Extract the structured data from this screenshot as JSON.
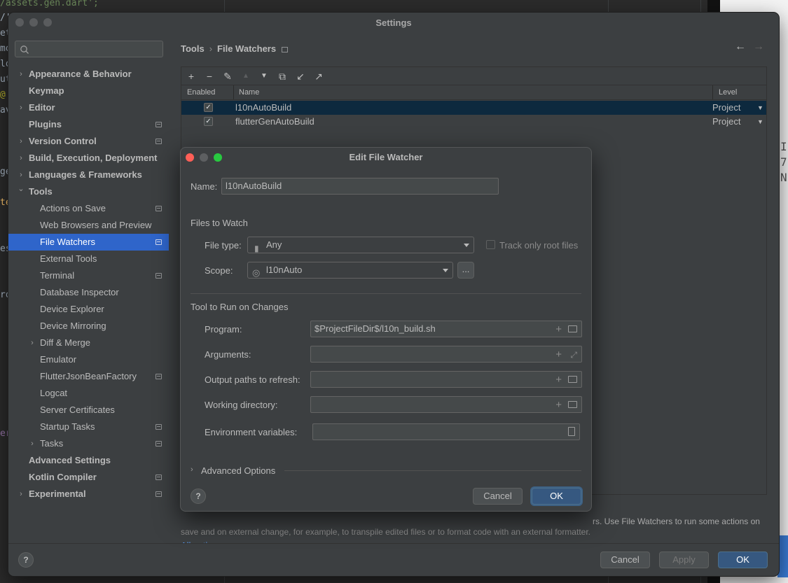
{
  "background_editor": {
    "code_lines": [
      "/assets.gen.dart';",
      "/'",
      "et",
      "mo",
      "lo",
      "ut",
      "@",
      "av",
      "ge",
      "te",
      "es",
      "ro",
      "er"
    ],
    "right_panel_glyphs": [
      "I",
      "7",
      "N"
    ]
  },
  "settings": {
    "window_title": "Settings",
    "search": {
      "placeholder": "",
      "value": ""
    },
    "sidebar": {
      "items": [
        {
          "label": "Appearance & Behavior",
          "bold": true,
          "arrow": "›",
          "level": 0,
          "project": false
        },
        {
          "label": "Keymap",
          "bold": true,
          "arrow": "",
          "level": 0,
          "project": false
        },
        {
          "label": "Editor",
          "bold": true,
          "arrow": "›",
          "level": 0,
          "project": false
        },
        {
          "label": "Plugins",
          "bold": true,
          "arrow": "",
          "level": 0,
          "project": true
        },
        {
          "label": "Version Control",
          "bold": true,
          "arrow": "›",
          "level": 0,
          "project": true
        },
        {
          "label": "Build, Execution, Deployment",
          "bold": true,
          "arrow": "›",
          "level": 0,
          "project": false
        },
        {
          "label": "Languages & Frameworks",
          "bold": true,
          "arrow": "›",
          "level": 0,
          "project": false
        },
        {
          "label": "Tools",
          "bold": true,
          "arrow": "⌄",
          "level": 0,
          "project": false
        },
        {
          "label": "Actions on Save",
          "bold": false,
          "arrow": "",
          "level": 1,
          "project": true
        },
        {
          "label": "Web Browsers and Preview",
          "bold": false,
          "arrow": "",
          "level": 1,
          "project": false
        },
        {
          "label": "File Watchers",
          "bold": true,
          "arrow": "",
          "level": 1,
          "project": true,
          "selected": true
        },
        {
          "label": "External Tools",
          "bold": false,
          "arrow": "",
          "level": 1,
          "project": false
        },
        {
          "label": "Terminal",
          "bold": false,
          "arrow": "",
          "level": 1,
          "project": true
        },
        {
          "label": "Database Inspector",
          "bold": false,
          "arrow": "",
          "level": 1,
          "project": false
        },
        {
          "label": "Device Explorer",
          "bold": false,
          "arrow": "",
          "level": 1,
          "project": false
        },
        {
          "label": "Device Mirroring",
          "bold": false,
          "arrow": "",
          "level": 1,
          "project": false
        },
        {
          "label": "Diff & Merge",
          "bold": false,
          "arrow": "›",
          "level": 1,
          "project": false
        },
        {
          "label": "Emulator",
          "bold": false,
          "arrow": "",
          "level": 1,
          "project": false
        },
        {
          "label": "FlutterJsonBeanFactory",
          "bold": false,
          "arrow": "",
          "level": 1,
          "project": true
        },
        {
          "label": "Logcat",
          "bold": false,
          "arrow": "",
          "level": 1,
          "project": false
        },
        {
          "label": "Server Certificates",
          "bold": false,
          "arrow": "",
          "level": 1,
          "project": false
        },
        {
          "label": "Startup Tasks",
          "bold": false,
          "arrow": "",
          "level": 1,
          "project": true
        },
        {
          "label": "Tasks",
          "bold": false,
          "arrow": "›",
          "level": 1,
          "project": true
        },
        {
          "label": "Advanced Settings",
          "bold": true,
          "arrow": "",
          "level": 0,
          "project": false
        },
        {
          "label": "Kotlin Compiler",
          "bold": true,
          "arrow": "",
          "level": 0,
          "project": true
        },
        {
          "label": "Experimental",
          "bold": true,
          "arrow": "›",
          "level": 0,
          "project": true
        }
      ]
    },
    "breadcrumb": {
      "parent": "Tools",
      "separator": "›",
      "current": "File Watchers"
    },
    "toolbar_icons": [
      "add-icon",
      "remove-icon",
      "edit-icon",
      "move-up-icon",
      "move-down-icon",
      "copy-icon",
      "import-icon",
      "export-icon"
    ],
    "table": {
      "headers": {
        "enabled": "Enabled",
        "name": "Name",
        "level": "Level"
      },
      "rows": [
        {
          "enabled": true,
          "name": "l10nAutoBuild",
          "level": "Project",
          "selected": true
        },
        {
          "enabled": true,
          "name": "flutterGenAutoBuild",
          "level": "Project",
          "selected": false
        }
      ]
    },
    "description": {
      "line1": "rs. Use File Watchers to run some actions on",
      "line2": "save and on external change, for example, to transpile edited files or to format code with an external formatter."
    },
    "all_actions_link": "All actions on save...",
    "footer": {
      "help": "?",
      "cancel": "Cancel",
      "apply": "Apply",
      "ok": "OK"
    }
  },
  "dialog": {
    "title": "Edit File Watcher",
    "name_label": "Name:",
    "name_value": "l10nAutoBuild",
    "files_section": "Files to Watch",
    "file_type_label": "File type:",
    "file_type_value": "Any",
    "track_root_label": "Track only root files",
    "track_root_checked": false,
    "scope_label": "Scope:",
    "scope_value": "l10nAuto",
    "scope_more": "...",
    "tool_section": "Tool to Run on Changes",
    "program_label": "Program:",
    "program_value": "$ProjectFileDir$/l10n_build.sh",
    "arguments_label": "Arguments:",
    "arguments_value": "",
    "output_label": "Output paths to refresh:",
    "output_value": "",
    "workdir_label": "Working directory:",
    "workdir_value": "",
    "env_label": "Environment variables:",
    "env_value": "",
    "advanced_label": "Advanced Options",
    "help": "?",
    "cancel": "Cancel",
    "ok": "OK"
  },
  "colors": {
    "accent": "#2f65ca",
    "selected_row": "#0d293e",
    "link": "#589df6",
    "default_button": "#365880"
  }
}
